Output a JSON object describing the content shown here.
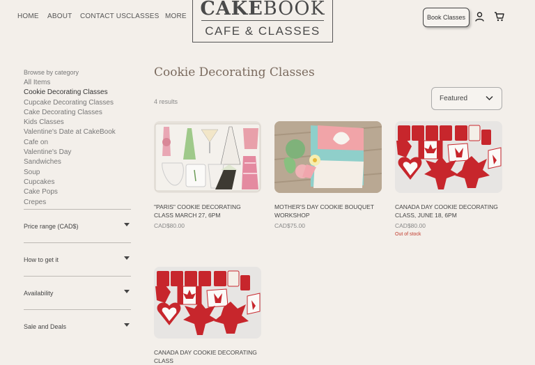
{
  "nav": {
    "home": "HOME",
    "about": "ABOUT",
    "contact": "CONTACT US",
    "classes": "CLASSES",
    "more": "MORE"
  },
  "logo": {
    "line1_bold": "CAKE",
    "line1_rest": "BOOK",
    "line2": "CAFE & CLASSES"
  },
  "header": {
    "book_label": "Book Classes"
  },
  "sidebar": {
    "browse_label": "Browse by category",
    "categories": [
      "All Items",
      "Cookie Decorating Classes",
      "Cupcake Decorating Classes",
      "Cake Decorating Classes",
      "Kids Classes",
      "Valentine's Date at CakeBook Cafe on",
      "Valentine's Day",
      "Sandwiches",
      "Soup",
      "Cupcakes",
      "Cake Pops",
      "Crepes"
    ],
    "filters": [
      "Price range (CAD$)",
      "How to get it",
      "Availability",
      "Sale and Deals"
    ]
  },
  "main": {
    "title": "Cookie Decorating Classes",
    "results": "4 results",
    "sort_value": "Featured",
    "products": [
      {
        "name": "\"PARIS\" COOKIE DECORATING CLASS MARCH 27, 6PM",
        "price": "CAD$80.00",
        "stock": ""
      },
      {
        "name": "MOTHER'S DAY COOKIE BOUQUET WORKSHOP",
        "price": "CAD$75.00",
        "stock": ""
      },
      {
        "name": "CANADA DAY COOKIE DECORATING CLASS, JUNE 18, 6PM",
        "price": "CAD$80.00",
        "stock": "Out of stock"
      },
      {
        "name": "CANADA DAY COOKIE DECORATING CLASS",
        "price": "",
        "stock": ""
      }
    ]
  },
  "colors": {
    "background": "#f3efea",
    "title": "#7a6a5e",
    "out_of_stock": "#c0392b"
  }
}
